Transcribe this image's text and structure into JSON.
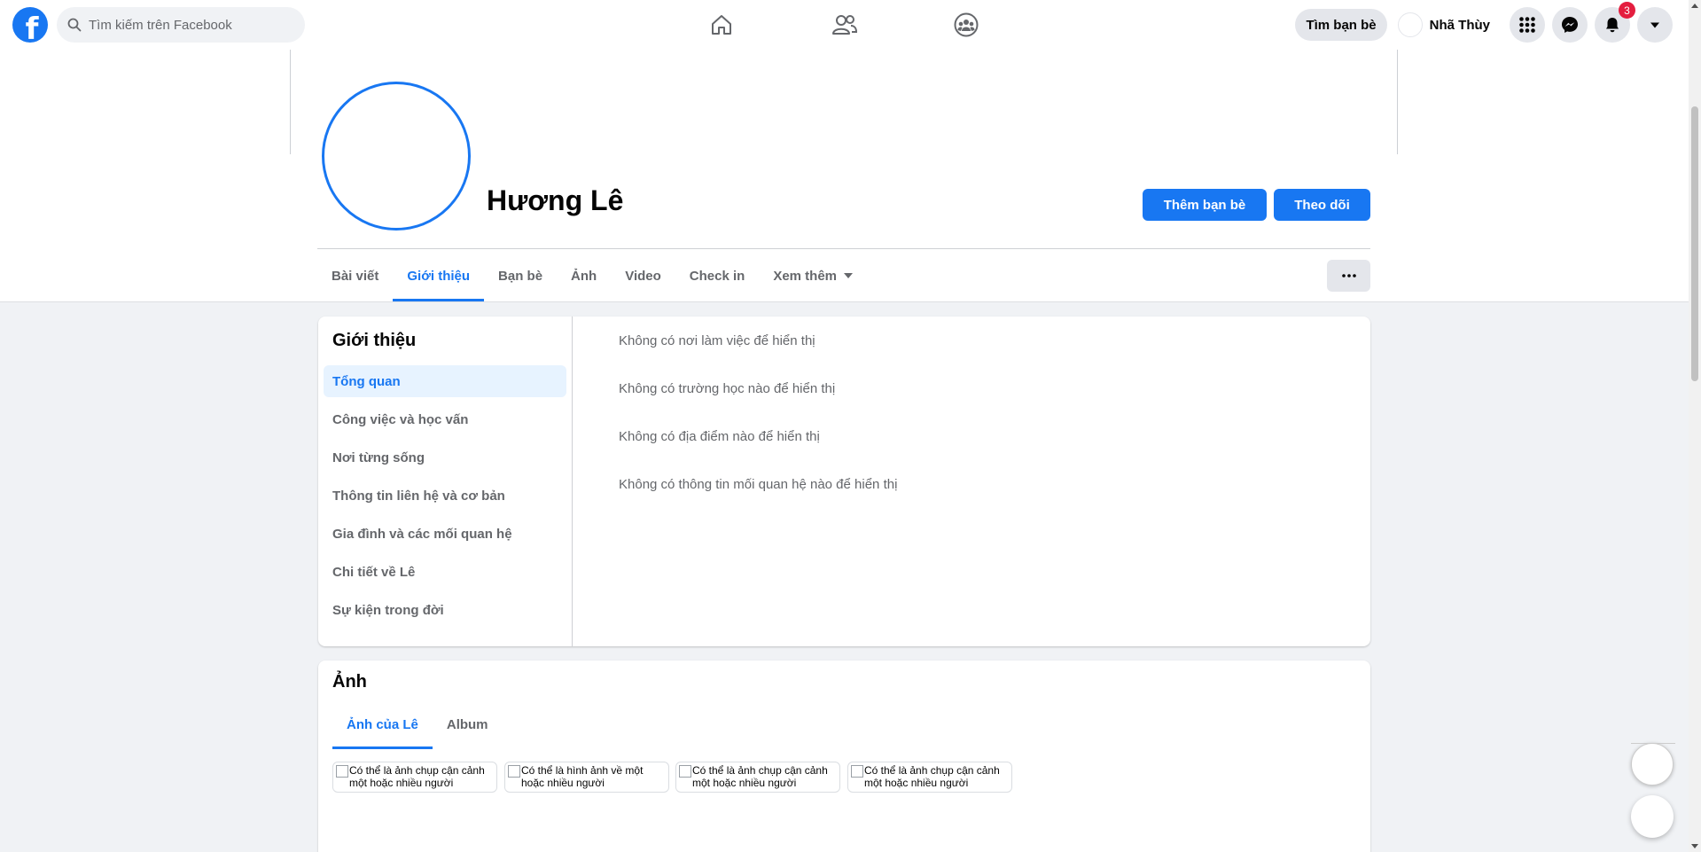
{
  "topbar": {
    "logo_letter": "f",
    "search_placeholder": "Tìm kiếm trên Facebook",
    "nav_icons": [
      "home-icon",
      "friends-icon",
      "groups-icon"
    ],
    "find_friends_label": "Tìm bạn bè",
    "user_name": "Nhã Thùy",
    "notification_count": "3"
  },
  "profile": {
    "name": "Hương Lê",
    "add_friend_label": "Thêm bạn bè",
    "follow_label": "Theo dõi"
  },
  "tabs": [
    {
      "label": "Bài viết",
      "active": false
    },
    {
      "label": "Giới thiệu",
      "active": true
    },
    {
      "label": "Bạn bè",
      "active": false
    },
    {
      "label": "Ảnh",
      "active": false
    },
    {
      "label": "Video",
      "active": false
    },
    {
      "label": "Check in",
      "active": false
    },
    {
      "label": "Xem thêm",
      "active": false
    }
  ],
  "about": {
    "title": "Giới thiệu",
    "nav": [
      "Tổng quan",
      "Công việc và học vấn",
      "Nơi từng sống",
      "Thông tin liên hệ và cơ bản",
      "Gia đình và các mối quan hệ",
      "Chi tiết về Lê",
      "Sự kiện trong đời"
    ],
    "empty_messages": [
      "Không có nơi làm việc để hiển thị",
      "Không có trường học nào để hiển thị",
      "Không có địa điểm nào để hiển thị",
      "Không có thông tin mối quan hệ nào để hiển thị"
    ]
  },
  "photos": {
    "title": "Ảnh",
    "tabs": [
      "Ảnh của Lê",
      "Album"
    ],
    "items": [
      "Có thể là ảnh chụp cận cảnh một hoặc nhiều người",
      "Có thể là hình ảnh về một hoặc nhiều người",
      "Có thể là ảnh chụp cận cảnh một hoặc nhiều người",
      "Có thể là ảnh chụp cận cảnh một hoặc nhiều người"
    ]
  },
  "colors": {
    "accent": "#1877f2",
    "background": "#f0f2f5",
    "badge": "#e41e3f"
  }
}
